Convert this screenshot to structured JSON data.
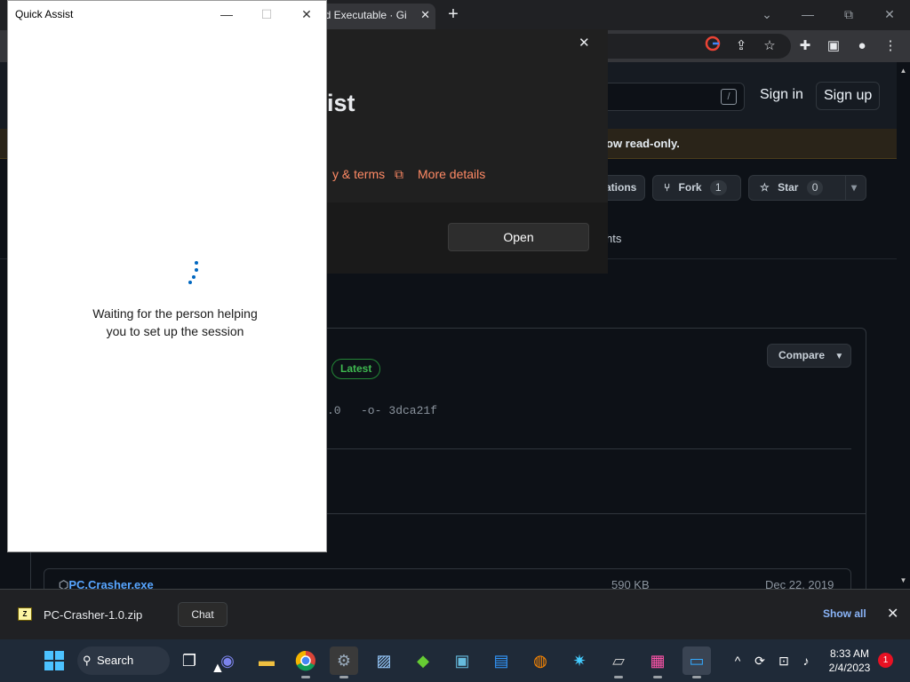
{
  "chrome": {
    "tab_title": "ed Executable · Gi",
    "tab_close": "✕",
    "new_tab": "+",
    "win_minimize": "—",
    "win_restore": "⧉",
    "win_close": "✕",
    "tab_search": "⌄"
  },
  "github": {
    "search_key": "/",
    "sign_in": "Sign in",
    "sign_up": "Sign up",
    "banner": "ow read-only.",
    "notifications_frag": "ations",
    "fork_label": "Fork",
    "fork_count": "1",
    "star_label": "Star",
    "star_count": "0",
    "insights_frag": "hts",
    "compare": "Compare",
    "latest": "Latest",
    "version_frag": ".0",
    "commit": "3dca21f",
    "asset_name": "PC.Crasher.exe",
    "asset_size": "590 KB",
    "asset_date": "Dec 22, 2019"
  },
  "dialog": {
    "title_frag": "ist",
    "terms_frag": "y & terms",
    "more_details": "More details",
    "open": "Open"
  },
  "quick_assist": {
    "title": "Quick Assist",
    "status": "Waiting for the person helping you to set up the session"
  },
  "download_bar": {
    "file_name": "PC-Crasher-1.0.zip",
    "chat_tooltip": "Chat",
    "show_all": "Show all"
  },
  "taskbar": {
    "search": "Search",
    "time": "8:33 AM",
    "date": "2/4/2023",
    "notification_count": "1"
  }
}
